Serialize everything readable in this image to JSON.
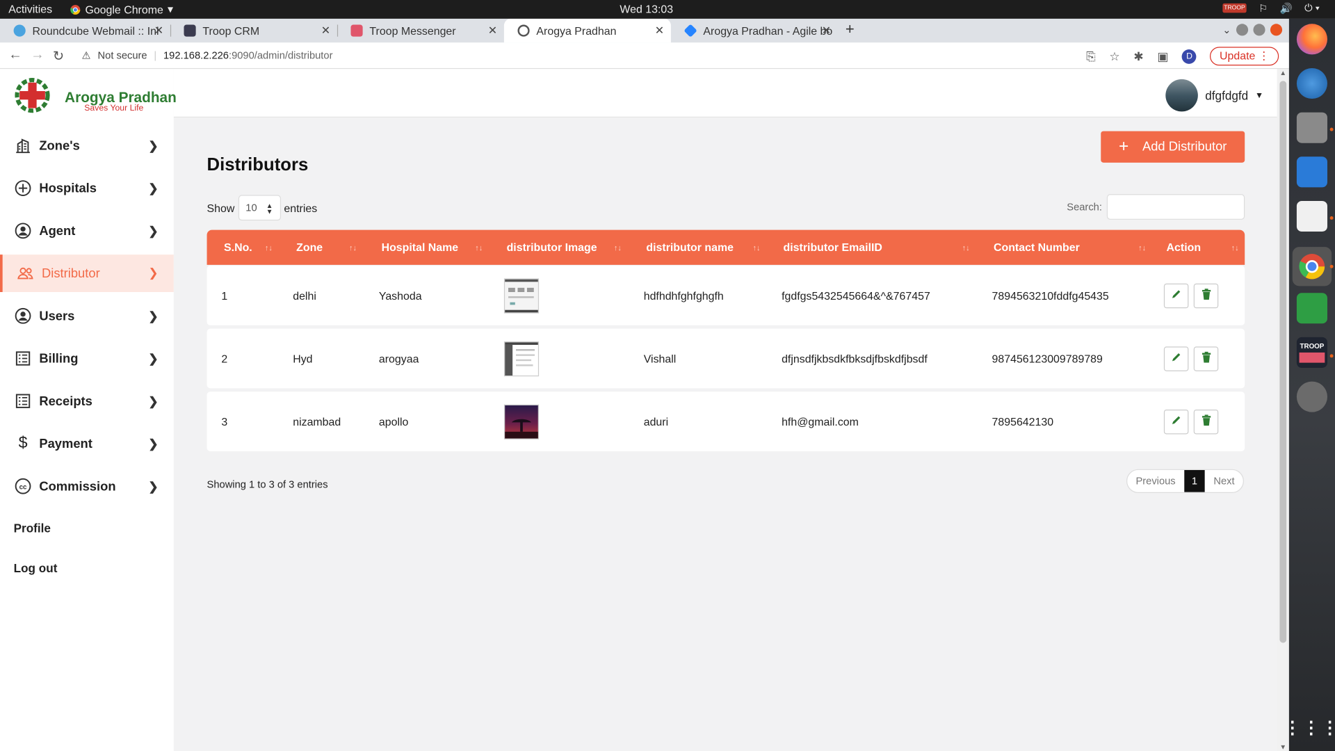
{
  "system": {
    "activities": "Activities",
    "app_name": "Google Chrome",
    "clock": "Wed 13:03",
    "troop_badge": "TROOP"
  },
  "browser": {
    "tabs": [
      {
        "label": "Roundcube Webmail :: Inl"
      },
      {
        "label": "Troop CRM"
      },
      {
        "label": "Troop Messenger"
      },
      {
        "label": "Arogya Pradhan"
      },
      {
        "label": "Arogya Pradhan - Agile bo"
      }
    ],
    "security": "Not secure",
    "url_host": "192.168.2.226",
    "url_path": ":9090/admin/distributor",
    "profile_initial": "D",
    "update_label": "Update"
  },
  "brand": {
    "name": "Arogya Pradhan",
    "tagline": "Saves Your Life"
  },
  "user": {
    "name": "dfgfdgfd"
  },
  "sidebar": {
    "items": [
      {
        "label": "Zone's",
        "icon": "building-icon"
      },
      {
        "label": "Hospitals",
        "icon": "plus-circle-icon"
      },
      {
        "label": "Agent",
        "icon": "user-circle-icon"
      },
      {
        "label": "Distributor",
        "icon": "users-icon"
      },
      {
        "label": "Users",
        "icon": "user-circle-icon"
      },
      {
        "label": "Billing",
        "icon": "list-icon"
      },
      {
        "label": "Receipts",
        "icon": "list-icon"
      },
      {
        "label": "Payment",
        "icon": "dollar-icon"
      },
      {
        "label": "Commission",
        "icon": "cc-icon"
      }
    ],
    "profile": "Profile",
    "logout": "Log out"
  },
  "main": {
    "title": "Distributors",
    "add_button": "Add Distributor",
    "show_label": "Show",
    "entries_value": "10",
    "entries_label": "entries",
    "search_label": "Search:",
    "columns": [
      "S.No.",
      "Zone",
      "Hospital Name",
      "distributor Image",
      "distributor name",
      "distributor EmailID",
      "Contact Number",
      "Action"
    ],
    "rows": [
      {
        "sno": "1",
        "zone": "delhi",
        "hospital": "Yashoda",
        "name": "hdfhdhfghfghgfh",
        "email": "fgdfgs5432545664&^&767457",
        "contact": "7894563210fddfg45435"
      },
      {
        "sno": "2",
        "zone": "Hyd",
        "hospital": "arogyaa",
        "name": "Vishall",
        "email": "dfjnsdfjkbsdkfbksdjfbskdfjbsdf",
        "contact": "987456123009789789"
      },
      {
        "sno": "3",
        "zone": "nizambad",
        "hospital": "apollo",
        "name": "aduri",
        "email": "hfh@gmail.com",
        "contact": "7895642130"
      }
    ],
    "info": "Showing 1 to 3 of 3 entries",
    "pager": {
      "prev": "Previous",
      "current": "1",
      "next": "Next"
    }
  },
  "colors": {
    "accent": "#f26a48",
    "edit_green": "#2e7d32",
    "brand_green": "#2e7d32",
    "brand_red": "#d32f2f"
  }
}
